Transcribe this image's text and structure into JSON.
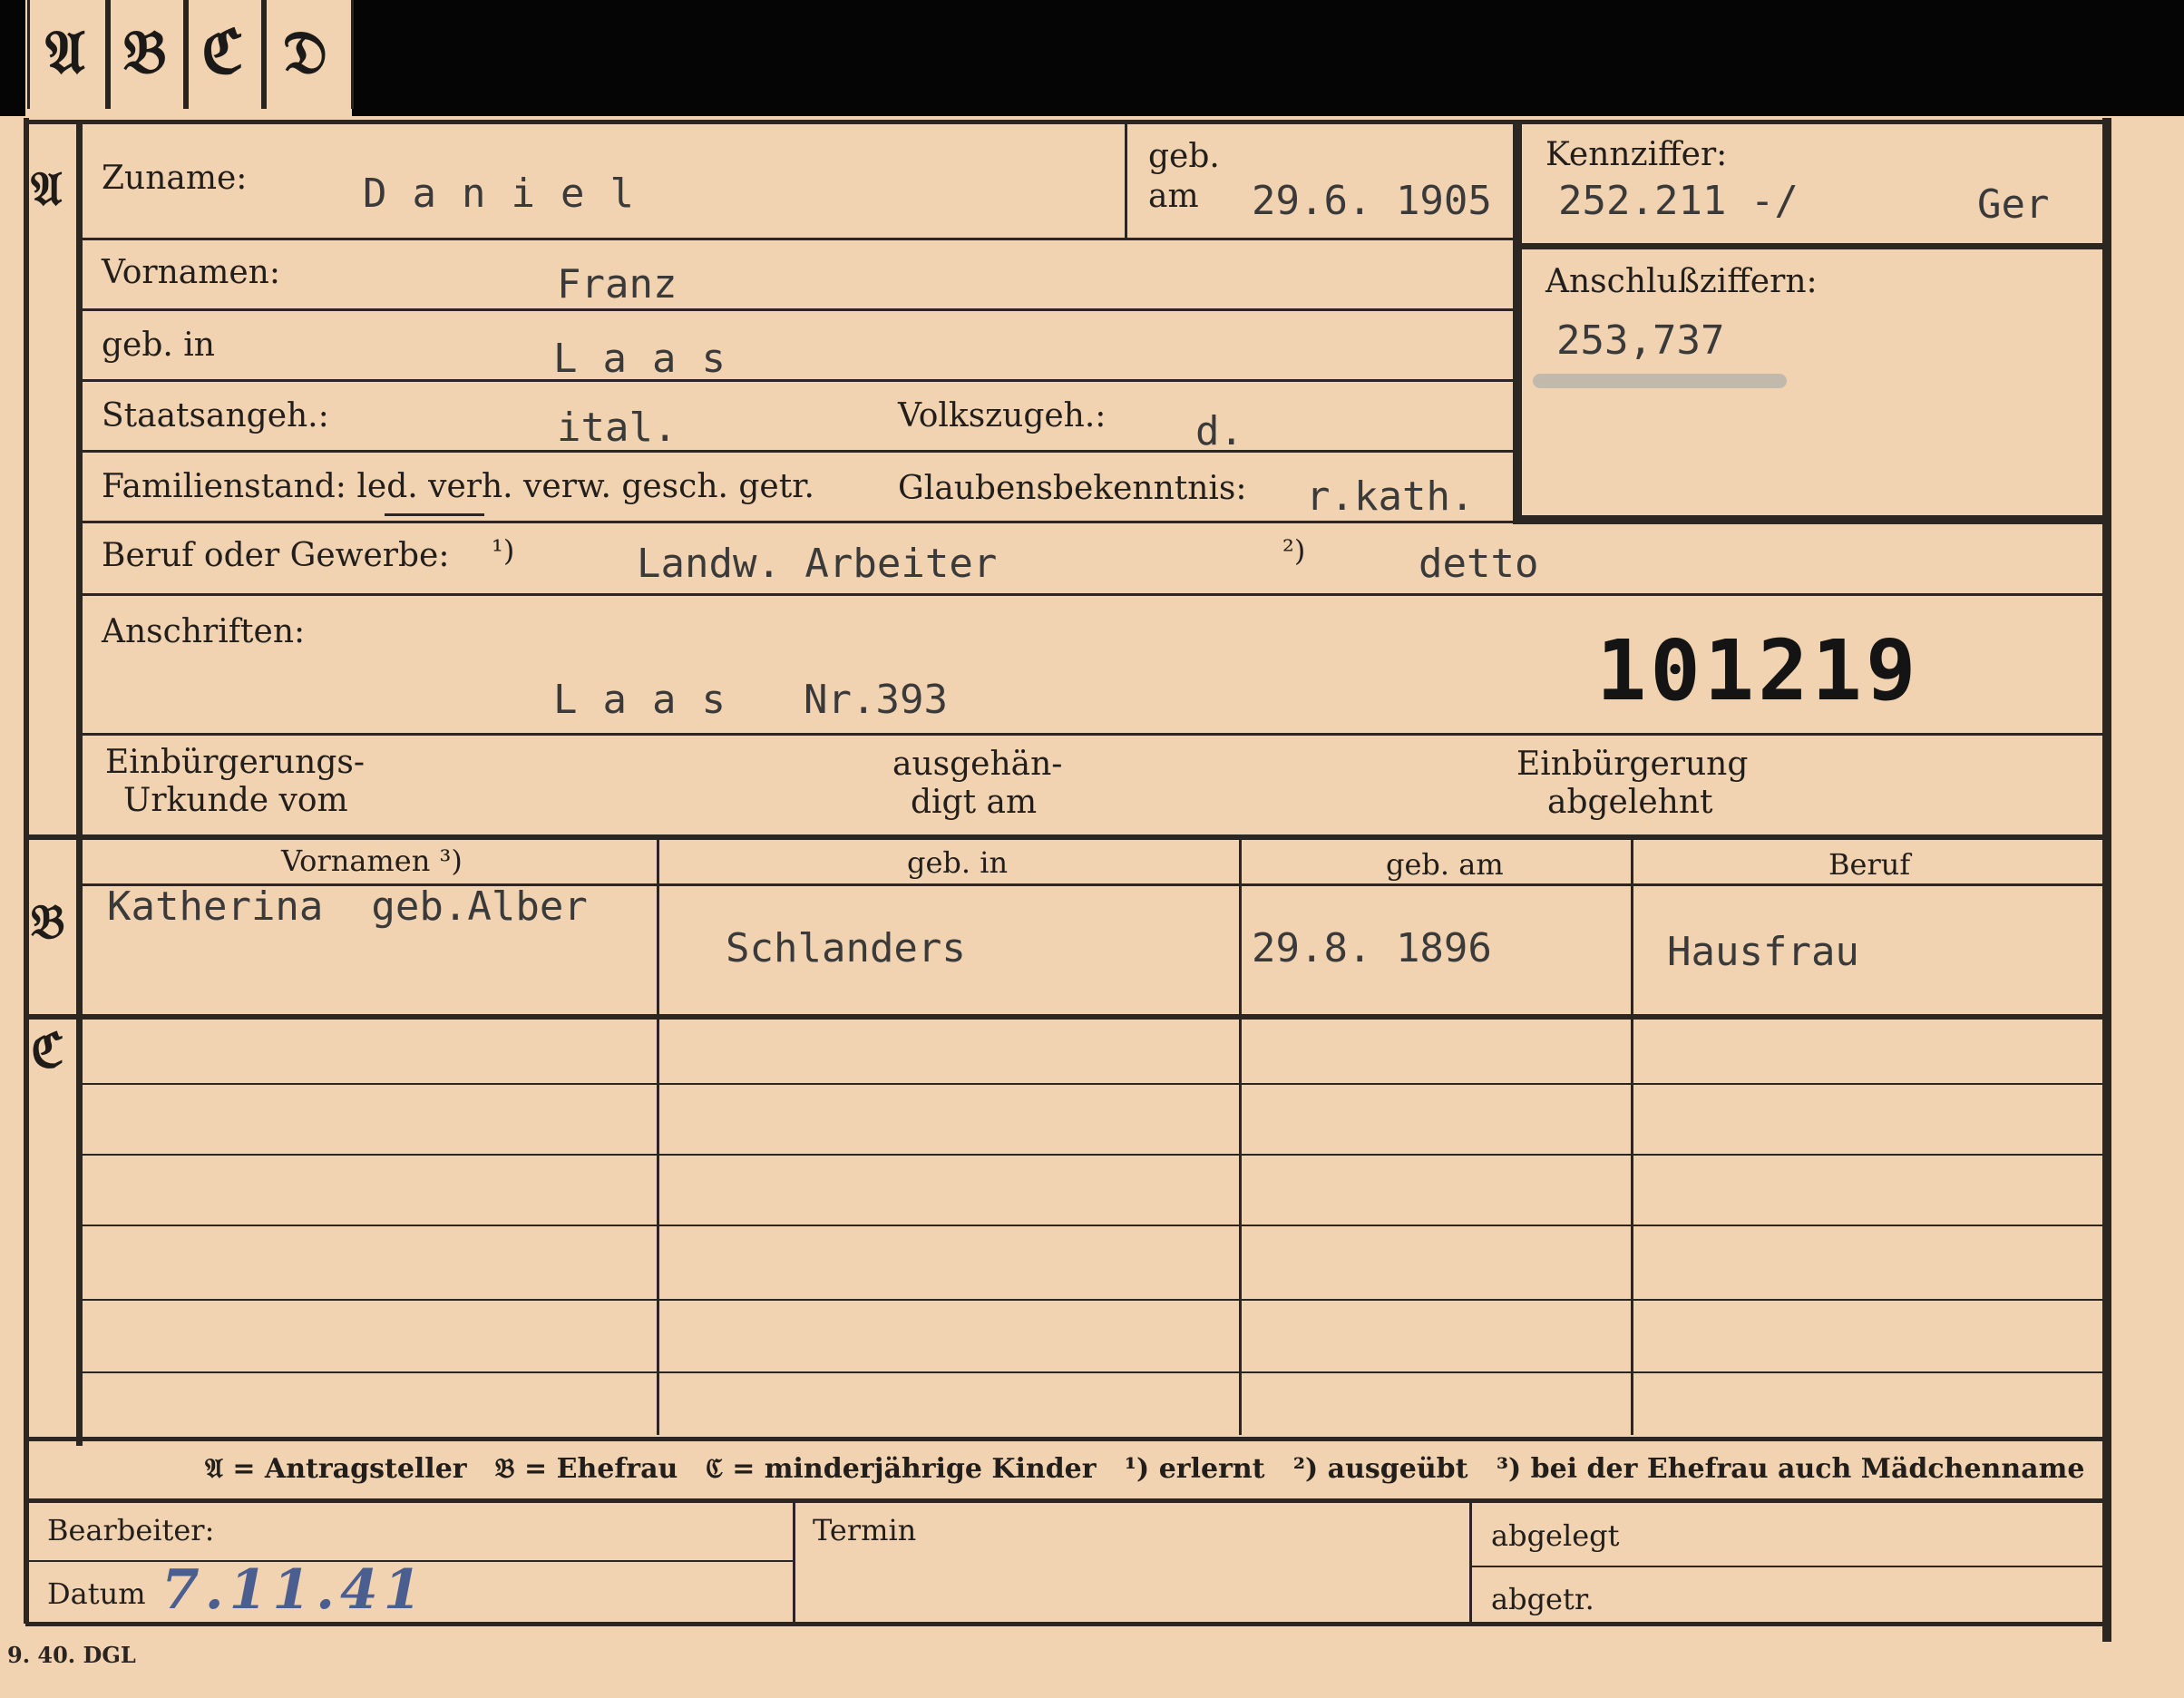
{
  "tabs": [
    "𝔄",
    "𝔅",
    "ℭ",
    "𝔇"
  ],
  "sections": {
    "a": "𝔄",
    "b": "𝔅",
    "c": "ℭ"
  },
  "labels": {
    "zuname": "Zuname:",
    "geb": "geb.",
    "am": "am",
    "kennziffer": "Kennziffer:",
    "vornamen": "Vornamen:",
    "anschluss": "Anschlußziffern:",
    "geb_in": "geb. in",
    "staats": "Staatsangeh.:",
    "volks": "Volkszugeh.:",
    "familien": "Familienstand: led. verh. verw. gesch. getr.",
    "glauben": "Glaubensbekenntnis:",
    "beruf": "Beruf oder Gewerbe:",
    "note1": "¹)",
    "note2": "²)",
    "anschriften": "Anschriften:",
    "einb1": "Einbürgerungs-",
    "einb2": "Urkunde vom",
    "ausg1": "ausgehän-",
    "ausg2": "digt am",
    "abgel1": "Einbürgerung",
    "abgel2": "abgelehnt"
  },
  "values": {
    "zuname": "Daniel",
    "geb_am": "29.6. 1905",
    "kennziffer": "252.211 -/",
    "kennziffer_suffix": "Ger",
    "vornamen": "Franz",
    "anschluss": "253,737",
    "geb_in": "Laas",
    "staats": "ital.",
    "volks": "d.",
    "glauben": "r.kath.",
    "beruf1": "Landw. Arbeiter",
    "beruf2": "detto",
    "anschrift": "Laas",
    "anschrift_nr": "Nr.393",
    "stamp": "101219"
  },
  "table": {
    "headers": [
      "Vornamen ³)",
      "geb. in",
      "geb. am",
      "Beruf"
    ],
    "row": [
      "Katherina  geb.Alber",
      "Schlanders",
      "29.8. 1896",
      "Hausfrau"
    ]
  },
  "legend": "𝔄 = Antragsteller   𝔅 = Ehefrau   ℭ = minderjährige Kinder   ¹) erlernt   ²) ausgeübt   ³) bei der Ehefrau auch Mädchenname",
  "footer": {
    "bearbeiter": "Bearbeiter:",
    "datum": "Datum",
    "datum_value": "7.11.41",
    "termin": "Termin",
    "abgelegt": "abgelegt",
    "abgetr": "abgetr."
  },
  "printer_mark": "9. 40. DGL"
}
